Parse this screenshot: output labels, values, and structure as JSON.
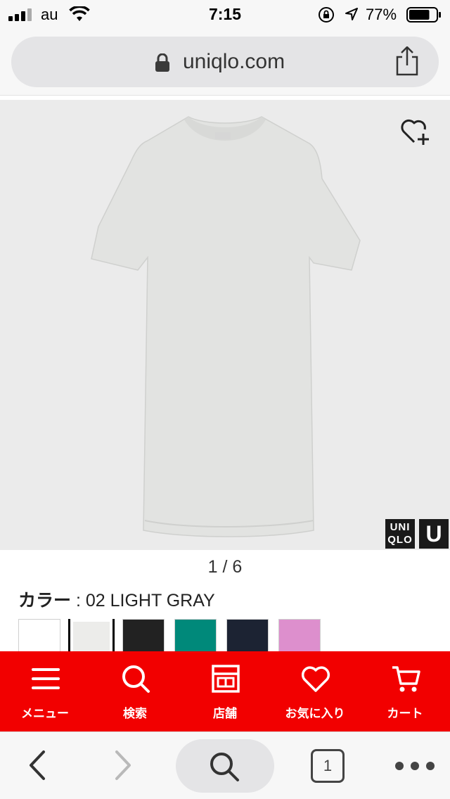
{
  "status_bar": {
    "carrier": "au",
    "time": "7:15",
    "battery": "77%",
    "battery_level": 0.77
  },
  "browser": {
    "url": "uniqlo.com"
  },
  "product": {
    "image_pager": "1 / 6",
    "color_key": "カラー",
    "color_sep": " : ",
    "color_value": "02 LIGHT GRAY",
    "brand_logo_text": "UNI QLO",
    "brand_logo_u": "U",
    "swatches": [
      {
        "color": "#ffffff",
        "selected": false
      },
      {
        "color": "#ececea",
        "selected": true
      },
      {
        "color": "#222222",
        "selected": false
      },
      {
        "color": "#00897a",
        "selected": false
      },
      {
        "color": "#1c2333",
        "selected": false
      },
      {
        "color": "#dd8fcd",
        "selected": false
      }
    ]
  },
  "nav": {
    "accent": "#f20000",
    "items": [
      {
        "label": "メニュー",
        "icon": "menu-icon"
      },
      {
        "label": "検索",
        "icon": "search-icon"
      },
      {
        "label": "店舗",
        "icon": "store-icon"
      },
      {
        "label": "お気に入り",
        "icon": "heart-icon"
      },
      {
        "label": "カート",
        "icon": "cart-icon"
      }
    ]
  },
  "toolbar": {
    "tab_count": "1"
  }
}
